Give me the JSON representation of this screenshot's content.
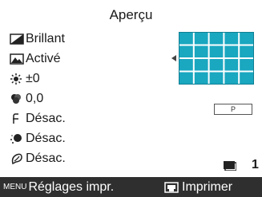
{
  "title": "Aperçu",
  "settings": [
    {
      "icon": "contrast-icon",
      "value": "Brillant"
    },
    {
      "icon": "image-optimize-icon",
      "value": "Activé"
    },
    {
      "icon": "brightness-icon",
      "value": "±0"
    },
    {
      "icon": "color-tone-icon",
      "value": "0,0"
    },
    {
      "icon": "red-eye-icon",
      "value": "Désac."
    },
    {
      "icon": "face-icon",
      "value": "Désac."
    },
    {
      "icon": "noise-reduction-icon",
      "value": "Désac."
    }
  ],
  "paper_badge": "P",
  "copies": "1",
  "bottom_bar": {
    "menu_key": "MENU",
    "menu_label": "Réglages impr.",
    "print_label": "Imprimer"
  },
  "colors": {
    "grid_cell": "#1aa7c0",
    "bar_bg": "#2f2f2f"
  }
}
